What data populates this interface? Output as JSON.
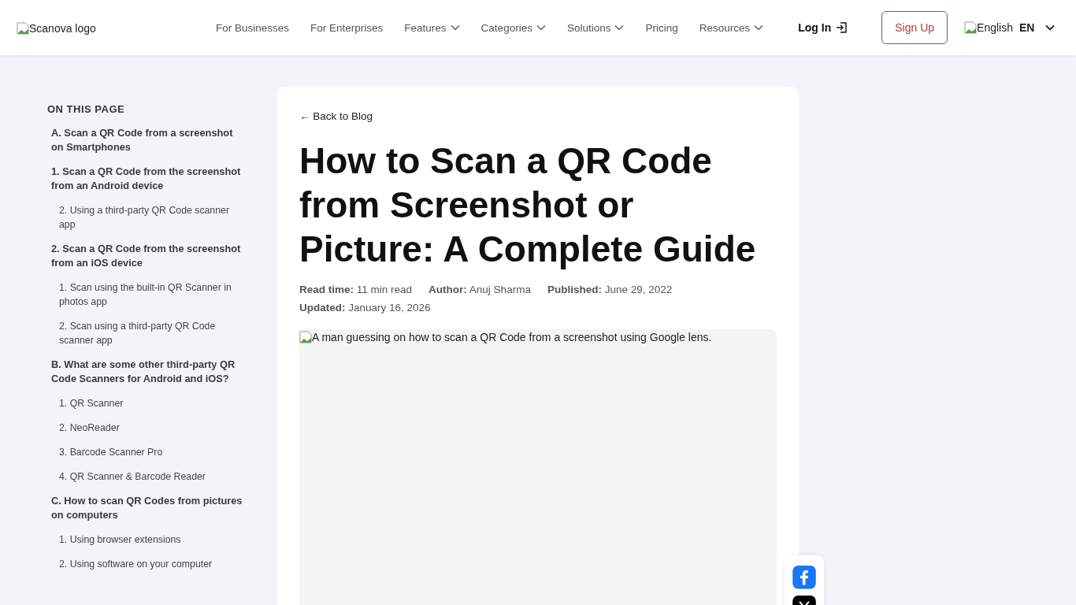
{
  "header": {
    "logo_alt": "Scanova logo",
    "nav": [
      {
        "label": "For Businesses",
        "dropdown": false
      },
      {
        "label": "For Enterprises",
        "dropdown": false
      },
      {
        "label": "Features",
        "dropdown": true
      },
      {
        "label": "Categories",
        "dropdown": true
      },
      {
        "label": "Solutions",
        "dropdown": true
      },
      {
        "label": "Pricing",
        "dropdown": false
      },
      {
        "label": "Resources",
        "dropdown": true
      }
    ],
    "login": "Log In",
    "signup": "Sign Up",
    "language_alt": "English",
    "language_code": "EN"
  },
  "toc": {
    "title": "ON THIS PAGE",
    "items": [
      {
        "label": "A. Scan a QR Code from a screenshot on Smartphones"
      },
      {
        "label": "1. Scan a QR Code from the screenshot from an Android device",
        "children": [
          {
            "label": "2. Using a third-party QR Code scanner app"
          }
        ]
      },
      {
        "label": "2. Scan a QR Code from the screenshot from an iOS device",
        "children": [
          {
            "label": "1. Scan using the built-in QR Scanner in photos app"
          },
          {
            "label": "2. Scan using a third-party QR Code scanner app"
          }
        ]
      },
      {
        "label": "B. What are some other third-party QR Code Scanners for Android and iOS?",
        "children": [
          {
            "label": "1. QR Scanner"
          },
          {
            "label": "2. NeoReader"
          },
          {
            "label": "3. Barcode Scanner Pro"
          },
          {
            "label": "4. QR Scanner & Barcode Reader"
          }
        ]
      },
      {
        "label": "C. How to scan QR Codes from pictures on computers",
        "children": [
          {
            "label": "1. Using browser extensions"
          },
          {
            "label": "2. Using software on your computer"
          }
        ]
      }
    ]
  },
  "article": {
    "back": "← Back to Blog",
    "title": "How to Scan a QR Code from Screenshot or Picture: A Complete Guide",
    "meta": [
      {
        "key": "Read time:",
        "value": "11 min read"
      },
      {
        "key": "Author:",
        "value": "Anuj Sharma"
      },
      {
        "key": "Published:",
        "value": "June 29, 2022"
      },
      {
        "key": "Updated:",
        "value": "January 16, 2026"
      }
    ],
    "image_alt": "A man guessing on how to scan a QR Code from a screenshot using Google lens."
  },
  "share": [
    {
      "kind": "facebook"
    },
    {
      "kind": "x"
    }
  ]
}
